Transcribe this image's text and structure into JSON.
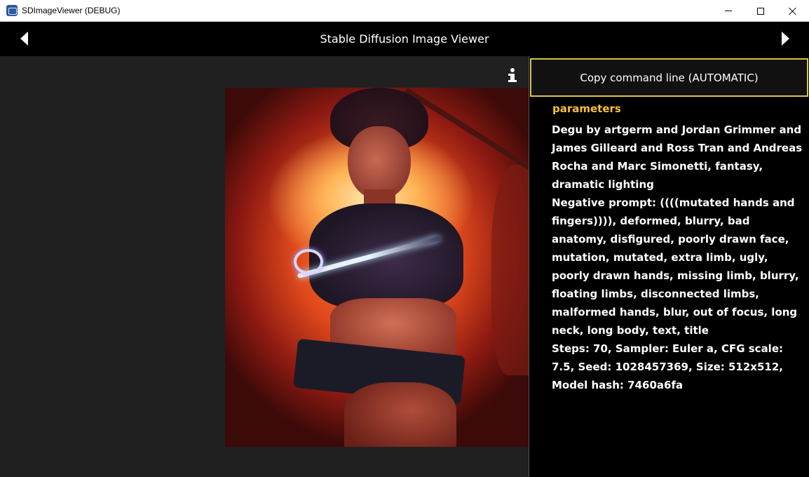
{
  "window": {
    "title": "SDImageViewer (DEBUG)"
  },
  "header": {
    "title": "Stable Diffusion Image Viewer"
  },
  "panel": {
    "copy_button_label": "Copy command line (AUTOMATIC)",
    "section_heading": "parameters",
    "prompt": "Degu by artgerm and Jordan Grimmer and James Gilleard and Ross Tran and Andreas Rocha and Marc Simonetti, fantasy, dramatic lighting",
    "negative_prompt": "Negative prompt: ((((mutated hands and fingers)))), deformed, blurry, bad anatomy, disfigured, poorly drawn face, mutation, mutated, extra limb, ugly, poorly drawn hands, missing limb, blurry, floating limbs, disconnected limbs, malformed hands, blur, out of focus, long neck, long body, text, title",
    "settings": "Steps: 70, Sampler: Euler a, CFG scale: 7.5, Seed: 1028457369, Size: 512x512, Model hash: 7460a6fa"
  },
  "colors": {
    "accent_border": "#d8c24a",
    "heading": "#f5c13a",
    "viewer_bg": "#202020"
  },
  "icons": [
    "app-icon",
    "minimize-icon",
    "maximize-icon",
    "close-icon",
    "arrow-left-icon",
    "arrow-right-icon",
    "info-icon"
  ]
}
